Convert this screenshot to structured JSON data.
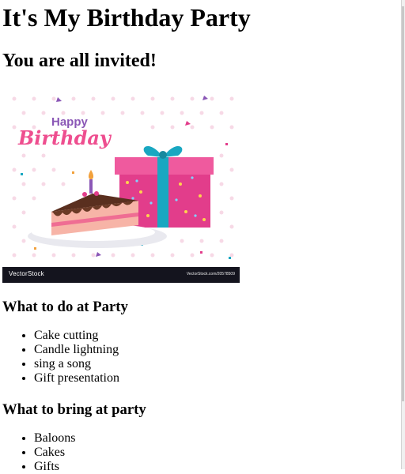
{
  "page": {
    "title": "It's My Birthday Party",
    "subtitle": "You are all invited!"
  },
  "image": {
    "greeting_line1": "Happy",
    "greeting_line2": "Birthday",
    "watermark_left": "VectorStock",
    "watermark_right": "VectorStock.com/20578509"
  },
  "sections": [
    {
      "heading": "What to do at Party",
      "items": [
        "Cake cutting",
        "Candle lightning",
        "sing a song",
        "Gift presentation"
      ]
    },
    {
      "heading": "What to bring at party",
      "items": [
        "Baloons",
        "Cakes",
        "Gifts"
      ]
    }
  ],
  "colors": {
    "gift_pink": "#e23d8b",
    "ribbon_teal": "#19a7c1",
    "happy_purple": "#8a57b6",
    "birthday_pink": "#ee4e8f"
  }
}
